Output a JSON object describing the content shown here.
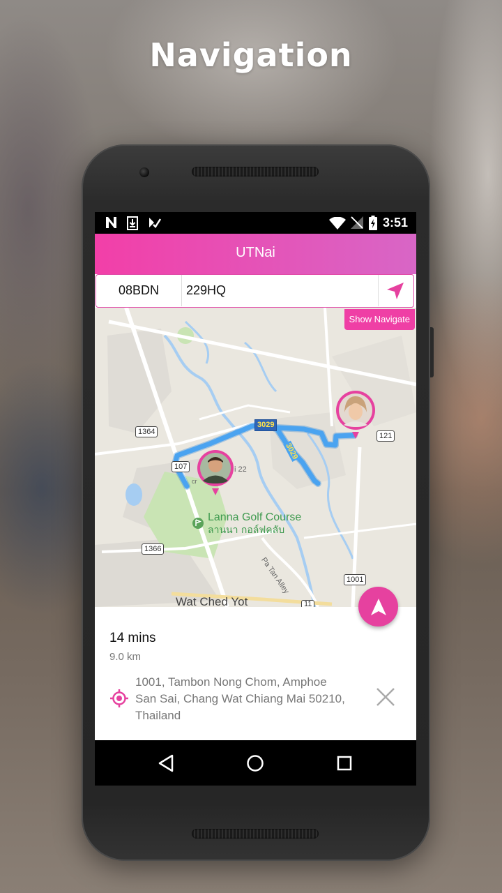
{
  "page": {
    "heading": "Navigation"
  },
  "status_bar": {
    "time": "3:51",
    "icons": [
      "n-notification-icon",
      "download-icon",
      "tasker-icon",
      "wifi-icon",
      "no-signal-icon",
      "battery-charging-icon"
    ]
  },
  "app_bar": {
    "title": "UTNai"
  },
  "search": {
    "origin_code": "08BDN",
    "destination_code": "229HQ",
    "go_icon": "navigation-arrow-icon"
  },
  "show_navigate_label": "Show Navigate",
  "map": {
    "labels": {
      "golf_course_en": "Lanna Golf Course",
      "golf_course_th": "ลานนา กอล์ฟคลับ",
      "temple": "Wat Ched Yot",
      "alley": "Pa Tan Alley",
      "road_3029_a": "3029",
      "road_3029_b": "3029",
      "road_1364": "1364",
      "road_107": "107",
      "road_1366": "1366",
      "road_121": "121",
      "road_1001": "1001",
      "road_11": "11",
      "street_22": "i 22",
      "street_cr": "cr"
    },
    "colors": {
      "route": "#4aa3f0",
      "marker": "#e6419f",
      "land": "#eae7df",
      "park": "#c9e4b4",
      "water": "#a6cdf2"
    }
  },
  "route_info": {
    "duration": "14 mins",
    "distance": "9.0 km",
    "address_lines": [
      "1001, Tambon Nong Chom, Amphoe",
      "San Sai, Chang Wat Chiang Mai 50210,",
      "Thailand"
    ]
  },
  "nav_bar": {
    "icons": [
      "back-icon",
      "home-icon",
      "recents-icon"
    ]
  },
  "colors": {
    "accent": "#e6419f",
    "accent_light": "#d866c6"
  }
}
